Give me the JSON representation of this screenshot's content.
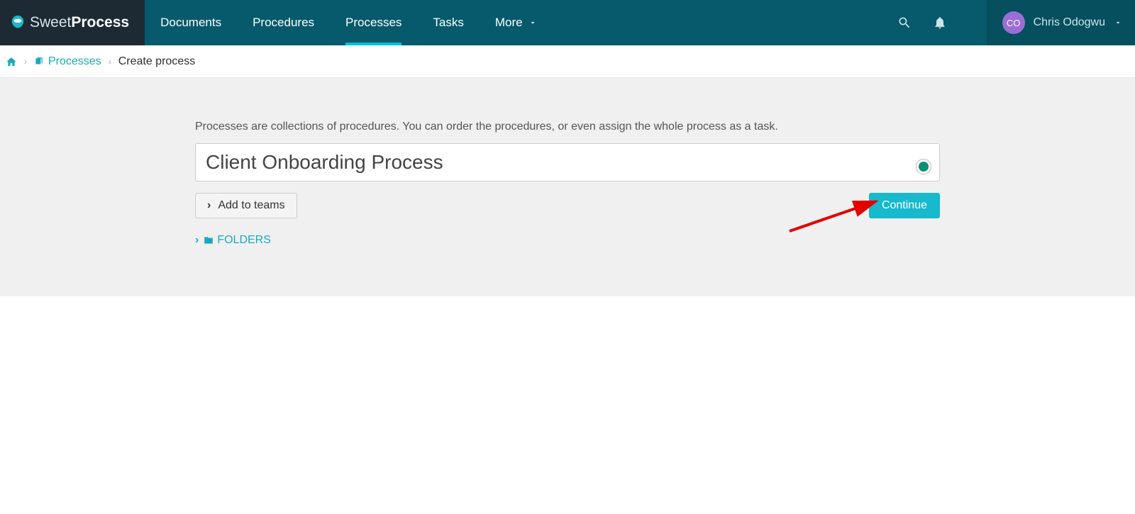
{
  "brand": {
    "part1": "Sweet",
    "part2": "Process"
  },
  "nav": {
    "documents": "Documents",
    "procedures": "Procedures",
    "processes": "Processes",
    "tasks": "Tasks",
    "more": "More"
  },
  "user": {
    "initials": "CO",
    "name": "Chris Odogwu"
  },
  "breadcrumb": {
    "processes": "Processes",
    "current": "Create process"
  },
  "form": {
    "hint": "Processes are collections of procedures. You can order the procedures, or even assign the whole process as a task.",
    "title_value": "Client Onboarding Process",
    "add_to_teams": "Add to teams",
    "continue": "Continue",
    "folders": "FOLDERS"
  }
}
